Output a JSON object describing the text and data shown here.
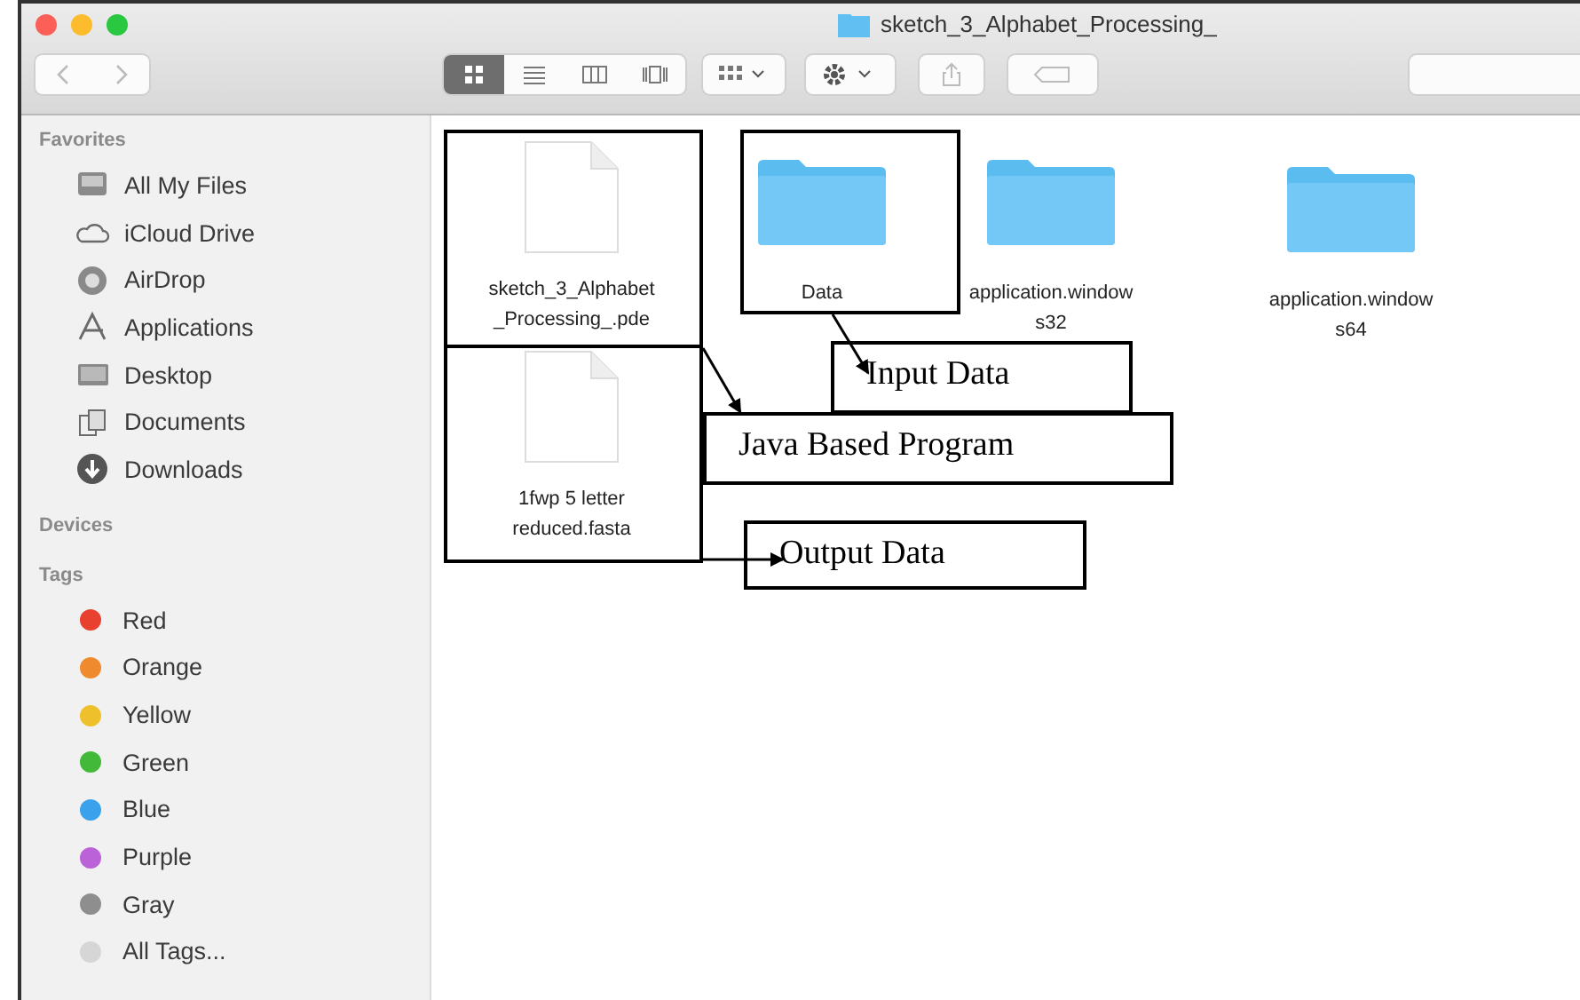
{
  "window": {
    "title": "sketch_3_Alphabet_Processing_"
  },
  "toolbar": {
    "view_modes": [
      {
        "kind": "icons",
        "selected": true
      },
      {
        "kind": "list",
        "selected": false
      },
      {
        "kind": "columns",
        "selected": false
      },
      {
        "kind": "coverflow",
        "selected": false
      }
    ]
  },
  "sidebar": {
    "favorites": {
      "heading": "Favorites",
      "items": [
        {
          "label": "All My Files",
          "kind": "files"
        },
        {
          "label": "iCloud Drive",
          "kind": "cloud"
        },
        {
          "label": "AirDrop",
          "kind": "airdrop"
        },
        {
          "label": "Applications",
          "kind": "apps"
        },
        {
          "label": "Desktop",
          "kind": "desktop"
        },
        {
          "label": "Documents",
          "kind": "documents"
        },
        {
          "label": "Downloads",
          "kind": "downloads"
        }
      ]
    },
    "devices": {
      "heading": "Devices"
    },
    "tags": {
      "heading": "Tags",
      "items": [
        {
          "label": "Red",
          "color": "#e8412f"
        },
        {
          "label": "Orange",
          "color": "#ef8a2e"
        },
        {
          "label": "Yellow",
          "color": "#eec02c"
        },
        {
          "label": "Green",
          "color": "#43b93a"
        },
        {
          "label": "Blue",
          "color": "#3aa2ec"
        },
        {
          "label": "Purple",
          "color": "#bb62d8"
        },
        {
          "label": "Gray",
          "color": "#8e8e8e"
        },
        {
          "label": "All Tags...",
          "color": "#d6d6d6"
        }
      ]
    }
  },
  "files": [
    {
      "kind": "document",
      "name_lines": [
        "sketch_3_Alphabet",
        "_Processing_.pde"
      ]
    },
    {
      "kind": "folder",
      "name_lines": [
        "Data"
      ]
    },
    {
      "kind": "folder",
      "name_lines": [
        "application.window",
        "s32"
      ]
    },
    {
      "kind": "folder",
      "name_lines": [
        "application.window",
        "s64"
      ]
    },
    {
      "kind": "document",
      "name_lines": [
        "1fwp 5 letter",
        "reduced.fasta"
      ]
    }
  ],
  "annotations": [
    {
      "label": "Input Data"
    },
    {
      "label": "Java Based Program"
    },
    {
      "label": "Output Data"
    }
  ]
}
